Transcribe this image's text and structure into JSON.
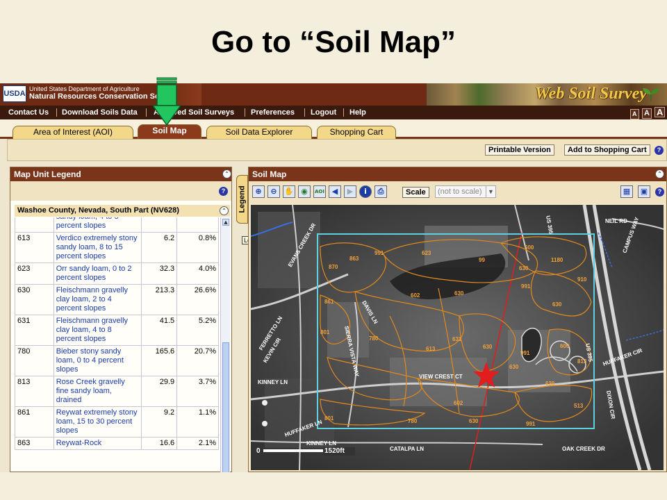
{
  "slide": {
    "title": "Go to “Soil Map”"
  },
  "banner": {
    "usda": "USDA",
    "agency_line1": "United States Department of Agriculture",
    "agency_line2": "Natural Resources Conservation Servi...",
    "brand": "Web Soil Survey"
  },
  "nav": {
    "items": [
      "Contact Us",
      "Download Soils Data",
      "Archived Soil Surveys",
      "Preferences",
      "Logout",
      "Help"
    ],
    "font_sizes": [
      "A",
      "A",
      "A"
    ]
  },
  "tabs": [
    "Area of Interest (AOI)",
    "Soil Map",
    "Soil Data Explorer",
    "Shopping Cart"
  ],
  "toolbar": {
    "printable": "Printable Version",
    "add_cart": "Add to Shopping Cart",
    "help": "?"
  },
  "left_panel": {
    "title": "Map Unit Legend",
    "county": "Washoe County, Nevada, South Part (NV628)",
    "partial_row": "sandy loam, 4 to 8 percent slopes",
    "rows": [
      {
        "symbol": "613",
        "name": "Verdico extremely stony sandy loam, 8 to 15 percent slopes",
        "acres": "6.2",
        "pct": "0.8%"
      },
      {
        "symbol": "623",
        "name": "Orr sandy loam, 0 to 2 percent slopes",
        "acres": "32.3",
        "pct": "4.0%"
      },
      {
        "symbol": "630",
        "name": "Fleischmann gravelly clay loam, 2 to 4 percent slopes",
        "acres": "213.3",
        "pct": "26.6%"
      },
      {
        "symbol": "631",
        "name": "Fleischmann gravelly clay loam, 4 to 8 percent slopes",
        "acres": "41.5",
        "pct": "5.2%"
      },
      {
        "symbol": "780",
        "name": "Bieber stony sandy loam, 0 to 4 percent slopes",
        "acres": "165.6",
        "pct": "20.7%"
      },
      {
        "symbol": "813",
        "name": "Rose Creek gravelly fine sandy loam, drained",
        "acres": "29.9",
        "pct": "3.7%"
      },
      {
        "symbol": "861",
        "name": "Reywat extremely stony loam, 15 to 30 percent slopes",
        "acres": "9.2",
        "pct": "1.1%"
      },
      {
        "symbol": "863",
        "name": "Reywat-Rock",
        "acres": "16.6",
        "pct": "2.1%"
      }
    ]
  },
  "legend_tab": {
    "label": "Legend",
    "tooltip": "Legend"
  },
  "right_panel": {
    "title": "Soil Map",
    "scale_label": "Scale",
    "scale_value": "(not to scale)",
    "scalebar_start": "0",
    "scalebar_end": "1520ft",
    "icons": [
      "zoom-in-icon",
      "zoom-out-icon",
      "pan-hand-icon",
      "globe-icon",
      "aoi-icon",
      "back-arrow-icon",
      "forward-arrow-icon",
      "info-icon",
      "print-icon"
    ]
  },
  "map": {
    "streets": [
      "EVANS CREEK DR",
      "DAVIS LN",
      "SIERRA VISTA WAY",
      "FERRETTO LN",
      "KEVIN CIR",
      "KINNEY LN",
      "VIEW CREST CT",
      "HUFFAKER LN",
      "CATALPA LN",
      "HUFFAKER CIR",
      "DIXON CIR",
      "OAK CREEK DR",
      "NEIL RD",
      "CAMPUS WAY",
      "US 395"
    ],
    "unit_labels": [
      "870",
      "863",
      "991",
      "623",
      "99",
      "600",
      "1180",
      "630",
      "991",
      "910",
      "630",
      "861",
      "602",
      "630",
      "801",
      "780",
      "631",
      "630",
      "991",
      "600",
      "813",
      "630",
      "780",
      "602",
      "630",
      "991",
      "801",
      "513",
      "630",
      "613"
    ]
  },
  "colors": {
    "header": "#7a3419",
    "nav": "#3b1a0e",
    "tab": "#f3d88a",
    "tab_active": "#8b3a1c",
    "soil_lines": "#e08a1e",
    "aoi": "#5fd0e0",
    "arrow": "#22c55e",
    "star": "#e11d1d"
  }
}
